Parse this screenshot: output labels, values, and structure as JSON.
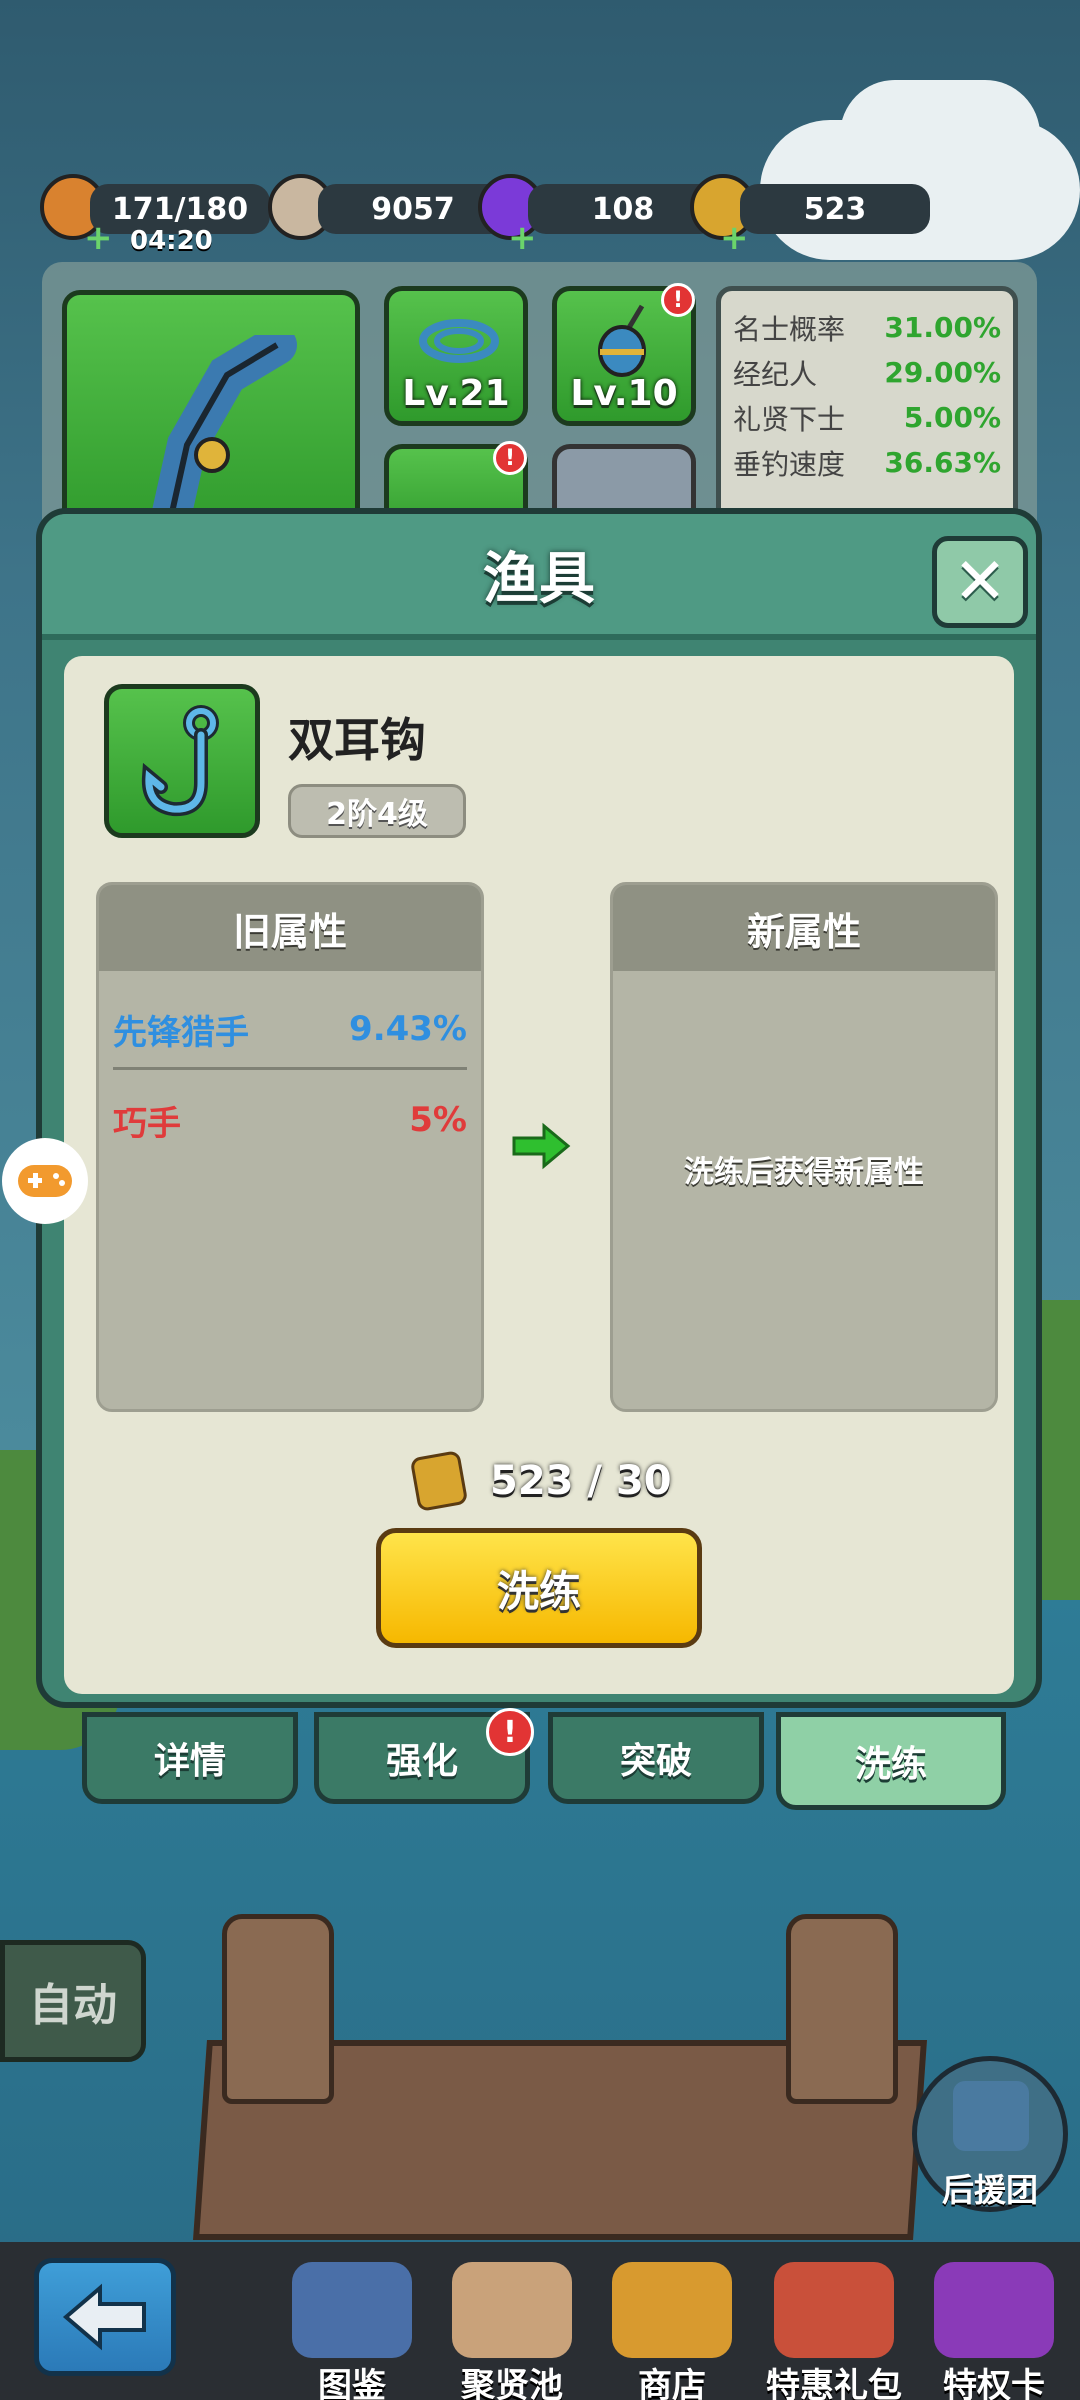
{
  "resources": {
    "stamina": "171/180",
    "timer": "04:20",
    "coins": "9057",
    "gems": "108",
    "tokens": "523"
  },
  "gear": {
    "slot1_level": "Lv.21",
    "slot2_level": "Lv.10"
  },
  "stats": [
    {
      "name": "名士概率",
      "value": "31.00%"
    },
    {
      "name": "经纪人",
      "value": "29.00%"
    },
    {
      "name": "礼贤下士",
      "value": "5.00%"
    },
    {
      "name": "垂钓速度",
      "value": "36.63%"
    }
  ],
  "modal": {
    "title": "渔具",
    "item_name": "双耳钩",
    "grade": "2阶4级",
    "old_header": "旧属性",
    "new_header": "新属性",
    "old_attrs": [
      {
        "name": "先锋猎手",
        "value": "9.43%",
        "color": "#2f8fe0"
      },
      {
        "name": "巧手",
        "value": "5%",
        "color": "#e03b3b"
      }
    ],
    "new_placeholder": "洗练后获得新属性",
    "cost": "523 / 30",
    "button": "洗练"
  },
  "tabs": [
    "详情",
    "强化",
    "突破",
    "洗练"
  ],
  "side": {
    "auto": "自动",
    "support": "后援团"
  },
  "nav": [
    "图鉴",
    "聚贤池",
    "商店",
    "特惠礼包",
    "特权卡"
  ],
  "colors": {
    "green_stat": "#2fa52f",
    "modal_green": "#3f8472",
    "button_yellow": "#ffd21f"
  }
}
